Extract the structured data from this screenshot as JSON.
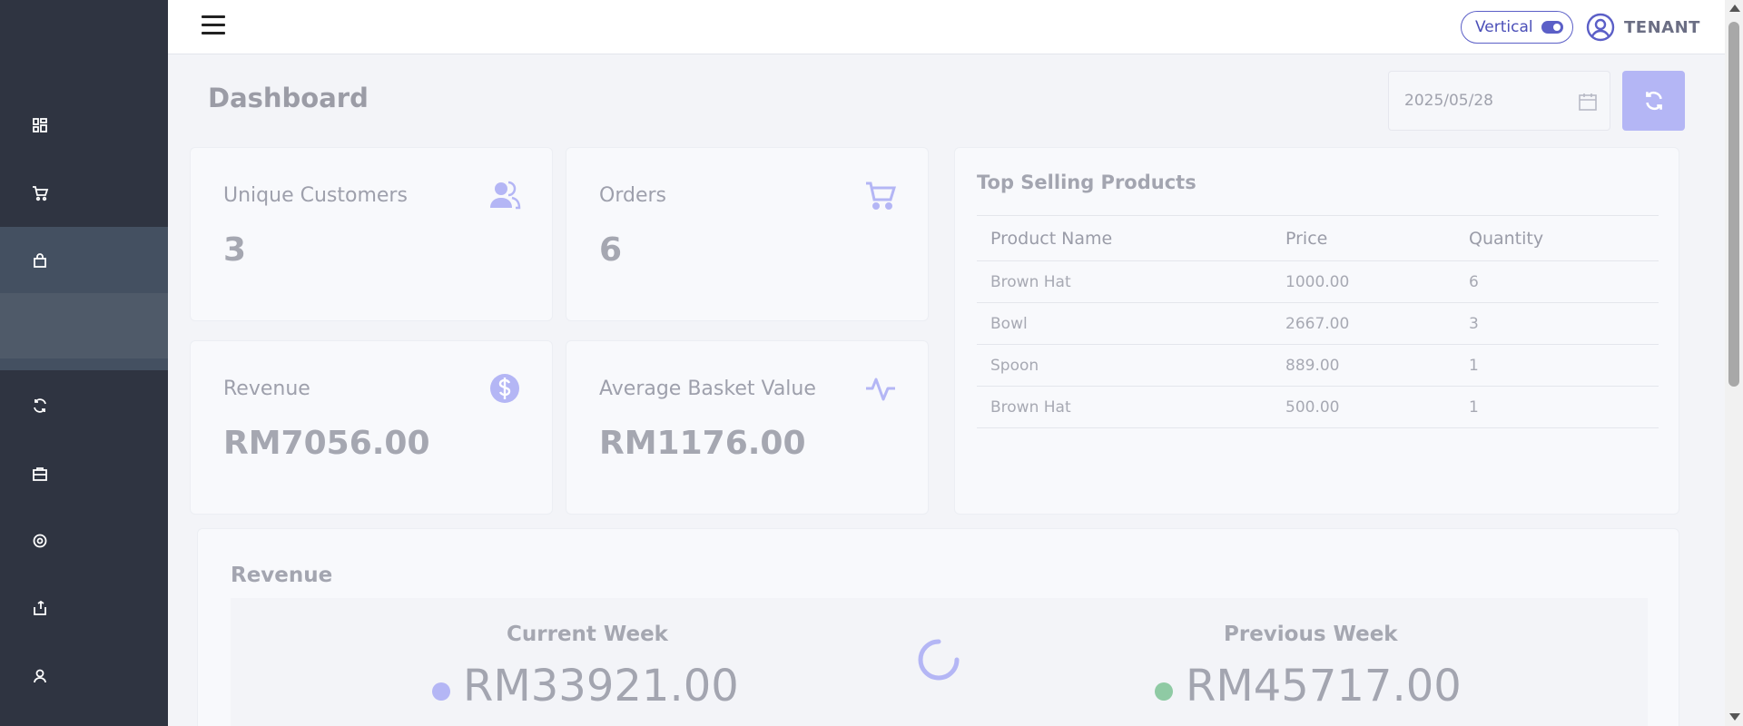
{
  "sidebar": {
    "items": [
      {
        "icon": "dashboard-icon"
      },
      {
        "icon": "cart-icon"
      },
      {
        "icon": "bag-icon"
      },
      {
        "icon": "refresh-icon"
      },
      {
        "icon": "briefcase-icon"
      },
      {
        "icon": "settings-icon"
      },
      {
        "icon": "export-icon"
      },
      {
        "icon": "user-icon"
      }
    ]
  },
  "topbar": {
    "layout_label": "Vertical",
    "user_name": "TENANT"
  },
  "page": {
    "title": "Dashboard",
    "date_value": "2025/05/28"
  },
  "stats": {
    "unique_customers": {
      "label": "Unique Customers",
      "value": "3",
      "icon": "users-icon"
    },
    "orders": {
      "label": "Orders",
      "value": "6",
      "icon": "cart-icon"
    },
    "revenue": {
      "label": "Revenue",
      "value": "RM7056.00",
      "icon": "dollar-icon"
    },
    "avg_basket": {
      "label": "Average Basket Value",
      "value": "RM1176.00",
      "icon": "activity-icon"
    }
  },
  "top_selling": {
    "title": "Top Selling Products",
    "columns": [
      "Product Name",
      "Price",
      "Quantity"
    ],
    "rows": [
      [
        "Brown Hat",
        "1000.00",
        "6"
      ],
      [
        "Bowl",
        "2667.00",
        "3"
      ],
      [
        "Spoon",
        "889.00",
        "1"
      ],
      [
        "Brown Hat",
        "500.00",
        "1"
      ]
    ]
  },
  "revenue_section": {
    "title": "Revenue",
    "current_week": {
      "label": "Current Week",
      "value": "RM33921.00",
      "color": "#b4b6f5"
    },
    "previous_week": {
      "label": "Previous Week",
      "value": "RM45717.00",
      "color": "#8fcaa4"
    }
  },
  "colors": {
    "sidebar_bg": "#2f3441",
    "accent": "#5b5fc7",
    "accent_light": "#b4b6f5"
  }
}
